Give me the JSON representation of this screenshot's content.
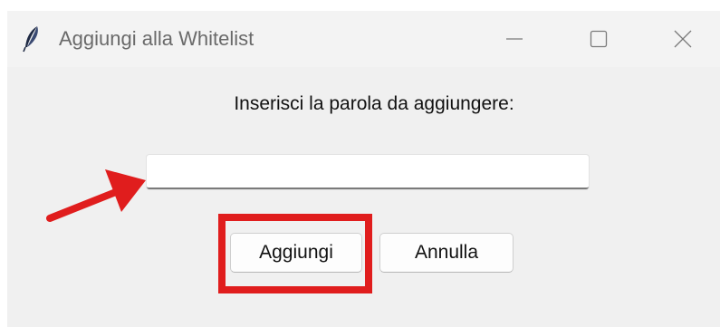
{
  "window": {
    "title": "Aggiungi alla Whitelist",
    "icon": "feather-icon",
    "controls": {
      "minimize_icon": "minimize-icon",
      "maximize_icon": "maximize-icon",
      "close_icon": "close-icon"
    }
  },
  "dialog": {
    "prompt": "Inserisci la parola da aggiungere:",
    "entry_value": "",
    "buttons": {
      "add_label": "Aggiungi",
      "cancel_label": "Annulla"
    }
  },
  "annotations": {
    "arrow_target": "word-entry",
    "highlighted": "add-button",
    "color": "#e01d1d"
  }
}
